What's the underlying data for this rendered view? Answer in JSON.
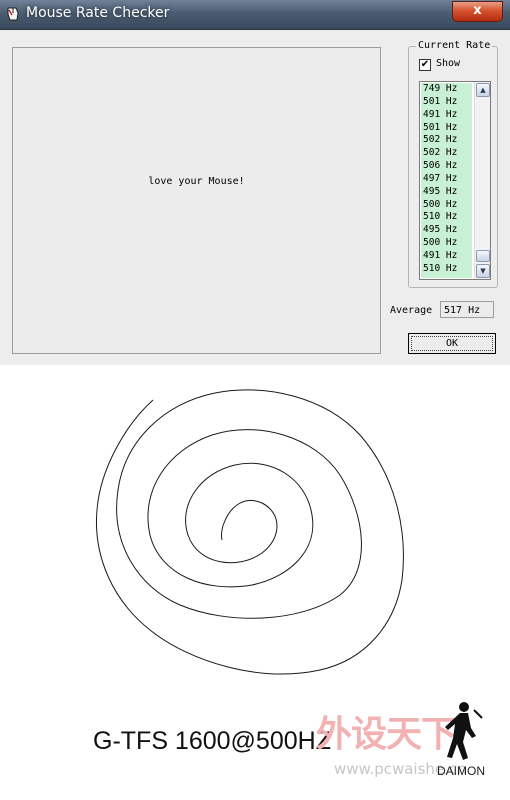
{
  "window": {
    "title": "Mouse Rate Checker",
    "close_label": "x"
  },
  "canvas": {
    "message": "love your Mouse!"
  },
  "current_rate": {
    "group_title": "Current Rate",
    "show_label": "Show",
    "show_checked": true,
    "items": [
      "749 Hz",
      "501 Hz",
      "491 Hz",
      "501 Hz",
      "502 Hz",
      "502 Hz",
      "506 Hz",
      "497 Hz",
      "495 Hz",
      "500 Hz",
      "510 Hz",
      "495 Hz",
      "500 Hz",
      "491 Hz",
      "510 Hz"
    ],
    "list_bg_color": "#c7f0d4"
  },
  "average": {
    "label": "Average",
    "value": "517 Hz"
  },
  "ok_label": "OK",
  "caption": "G-TFS 1600@500HZ",
  "watermark": {
    "logo_text": "外设天下",
    "url": "www.pcwaishe.cn",
    "signature": "DAIMON"
  }
}
